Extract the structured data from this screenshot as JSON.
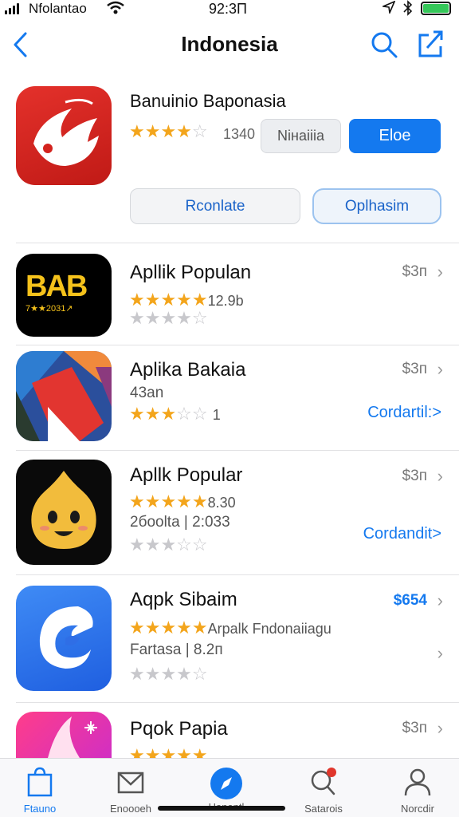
{
  "status_bar": {
    "carrier": "Nfolantao",
    "time": "92:3Π"
  },
  "nav": {
    "title": "Indonesia"
  },
  "featured": {
    "title": "Banuinio Baponasia",
    "rating": 4,
    "rating_count": "1340",
    "secondary_button": "Niнaiiia",
    "primary_button": "Eloe",
    "button_left": "Rconlate",
    "button_right": "Oplhasim"
  },
  "apps": [
    {
      "title": "Apllik Populan",
      "price": "$3п",
      "icon_text": "BAB",
      "icon_subtext": "7★★2031↗",
      "rating": 4.5,
      "rating_text": "12.9b",
      "second_rating": 4
    },
    {
      "title": "Aplika Bakaia",
      "price": "$3п",
      "subtitle": "43an",
      "rating": 3,
      "rating_text": "1",
      "link": "Cordartil:>"
    },
    {
      "title": "Apllk Popular",
      "price": "$3п",
      "rating": 4.5,
      "rating_text": "8.30",
      "subtitle": "2бoolta | 2:033",
      "second_rating": 2,
      "link": "Cordandit>"
    },
    {
      "title": "Aqpk Sibaim",
      "price": "$654",
      "rating": 4.5,
      "rating_text": "Arpalk Fndonaiiagu",
      "subtitle": "Fartasa | 8.2п",
      "second_rating": 4
    },
    {
      "title": "Pqok Papia",
      "price": "$3п"
    }
  ],
  "tabs": [
    {
      "label": "Ftauno",
      "icon": "bag-icon",
      "active": true
    },
    {
      "label": "Enoooeh",
      "icon": "envelope-icon"
    },
    {
      "label": "Hanantl",
      "icon": "compass-icon"
    },
    {
      "label": "Satarois",
      "icon": "search-icon"
    },
    {
      "label": "Norcdir",
      "icon": "person-icon"
    }
  ],
  "colors": {
    "accent": "#1479ef",
    "star": "#f3a51c",
    "star_off": "#c8c8cc",
    "badge": "#e0362c"
  }
}
